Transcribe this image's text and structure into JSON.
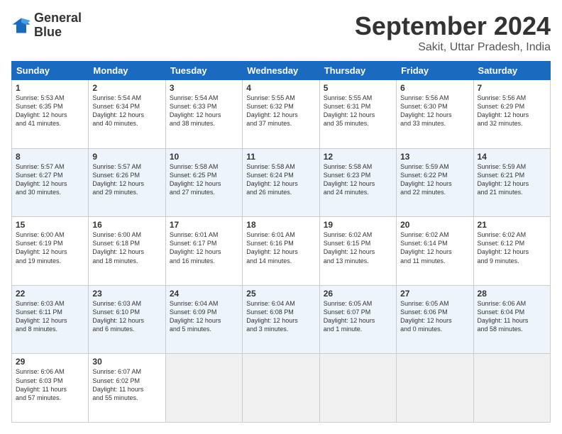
{
  "logo": {
    "line1": "General",
    "line2": "Blue"
  },
  "header": {
    "month": "September 2024",
    "location": "Sakit, Uttar Pradesh, India"
  },
  "weekdays": [
    "Sunday",
    "Monday",
    "Tuesday",
    "Wednesday",
    "Thursday",
    "Friday",
    "Saturday"
  ],
  "weeks": [
    [
      {
        "day": "1",
        "info": "Sunrise: 5:53 AM\nSunset: 6:35 PM\nDaylight: 12 hours\nand 41 minutes."
      },
      {
        "day": "2",
        "info": "Sunrise: 5:54 AM\nSunset: 6:34 PM\nDaylight: 12 hours\nand 40 minutes."
      },
      {
        "day": "3",
        "info": "Sunrise: 5:54 AM\nSunset: 6:33 PM\nDaylight: 12 hours\nand 38 minutes."
      },
      {
        "day": "4",
        "info": "Sunrise: 5:55 AM\nSunset: 6:32 PM\nDaylight: 12 hours\nand 37 minutes."
      },
      {
        "day": "5",
        "info": "Sunrise: 5:55 AM\nSunset: 6:31 PM\nDaylight: 12 hours\nand 35 minutes."
      },
      {
        "day": "6",
        "info": "Sunrise: 5:56 AM\nSunset: 6:30 PM\nDaylight: 12 hours\nand 33 minutes."
      },
      {
        "day": "7",
        "info": "Sunrise: 5:56 AM\nSunset: 6:29 PM\nDaylight: 12 hours\nand 32 minutes."
      }
    ],
    [
      {
        "day": "8",
        "info": "Sunrise: 5:57 AM\nSunset: 6:27 PM\nDaylight: 12 hours\nand 30 minutes."
      },
      {
        "day": "9",
        "info": "Sunrise: 5:57 AM\nSunset: 6:26 PM\nDaylight: 12 hours\nand 29 minutes."
      },
      {
        "day": "10",
        "info": "Sunrise: 5:58 AM\nSunset: 6:25 PM\nDaylight: 12 hours\nand 27 minutes."
      },
      {
        "day": "11",
        "info": "Sunrise: 5:58 AM\nSunset: 6:24 PM\nDaylight: 12 hours\nand 26 minutes."
      },
      {
        "day": "12",
        "info": "Sunrise: 5:58 AM\nSunset: 6:23 PM\nDaylight: 12 hours\nand 24 minutes."
      },
      {
        "day": "13",
        "info": "Sunrise: 5:59 AM\nSunset: 6:22 PM\nDaylight: 12 hours\nand 22 minutes."
      },
      {
        "day": "14",
        "info": "Sunrise: 5:59 AM\nSunset: 6:21 PM\nDaylight: 12 hours\nand 21 minutes."
      }
    ],
    [
      {
        "day": "15",
        "info": "Sunrise: 6:00 AM\nSunset: 6:19 PM\nDaylight: 12 hours\nand 19 minutes."
      },
      {
        "day": "16",
        "info": "Sunrise: 6:00 AM\nSunset: 6:18 PM\nDaylight: 12 hours\nand 18 minutes."
      },
      {
        "day": "17",
        "info": "Sunrise: 6:01 AM\nSunset: 6:17 PM\nDaylight: 12 hours\nand 16 minutes."
      },
      {
        "day": "18",
        "info": "Sunrise: 6:01 AM\nSunset: 6:16 PM\nDaylight: 12 hours\nand 14 minutes."
      },
      {
        "day": "19",
        "info": "Sunrise: 6:02 AM\nSunset: 6:15 PM\nDaylight: 12 hours\nand 13 minutes."
      },
      {
        "day": "20",
        "info": "Sunrise: 6:02 AM\nSunset: 6:14 PM\nDaylight: 12 hours\nand 11 minutes."
      },
      {
        "day": "21",
        "info": "Sunrise: 6:02 AM\nSunset: 6:12 PM\nDaylight: 12 hours\nand 9 minutes."
      }
    ],
    [
      {
        "day": "22",
        "info": "Sunrise: 6:03 AM\nSunset: 6:11 PM\nDaylight: 12 hours\nand 8 minutes."
      },
      {
        "day": "23",
        "info": "Sunrise: 6:03 AM\nSunset: 6:10 PM\nDaylight: 12 hours\nand 6 minutes."
      },
      {
        "day": "24",
        "info": "Sunrise: 6:04 AM\nSunset: 6:09 PM\nDaylight: 12 hours\nand 5 minutes."
      },
      {
        "day": "25",
        "info": "Sunrise: 6:04 AM\nSunset: 6:08 PM\nDaylight: 12 hours\nand 3 minutes."
      },
      {
        "day": "26",
        "info": "Sunrise: 6:05 AM\nSunset: 6:07 PM\nDaylight: 12 hours\nand 1 minute."
      },
      {
        "day": "27",
        "info": "Sunrise: 6:05 AM\nSunset: 6:06 PM\nDaylight: 12 hours\nand 0 minutes."
      },
      {
        "day": "28",
        "info": "Sunrise: 6:06 AM\nSunset: 6:04 PM\nDaylight: 11 hours\nand 58 minutes."
      }
    ],
    [
      {
        "day": "29",
        "info": "Sunrise: 6:06 AM\nSunset: 6:03 PM\nDaylight: 11 hours\nand 57 minutes."
      },
      {
        "day": "30",
        "info": "Sunrise: 6:07 AM\nSunset: 6:02 PM\nDaylight: 11 hours\nand 55 minutes."
      },
      {
        "day": "",
        "info": ""
      },
      {
        "day": "",
        "info": ""
      },
      {
        "day": "",
        "info": ""
      },
      {
        "day": "",
        "info": ""
      },
      {
        "day": "",
        "info": ""
      }
    ]
  ]
}
